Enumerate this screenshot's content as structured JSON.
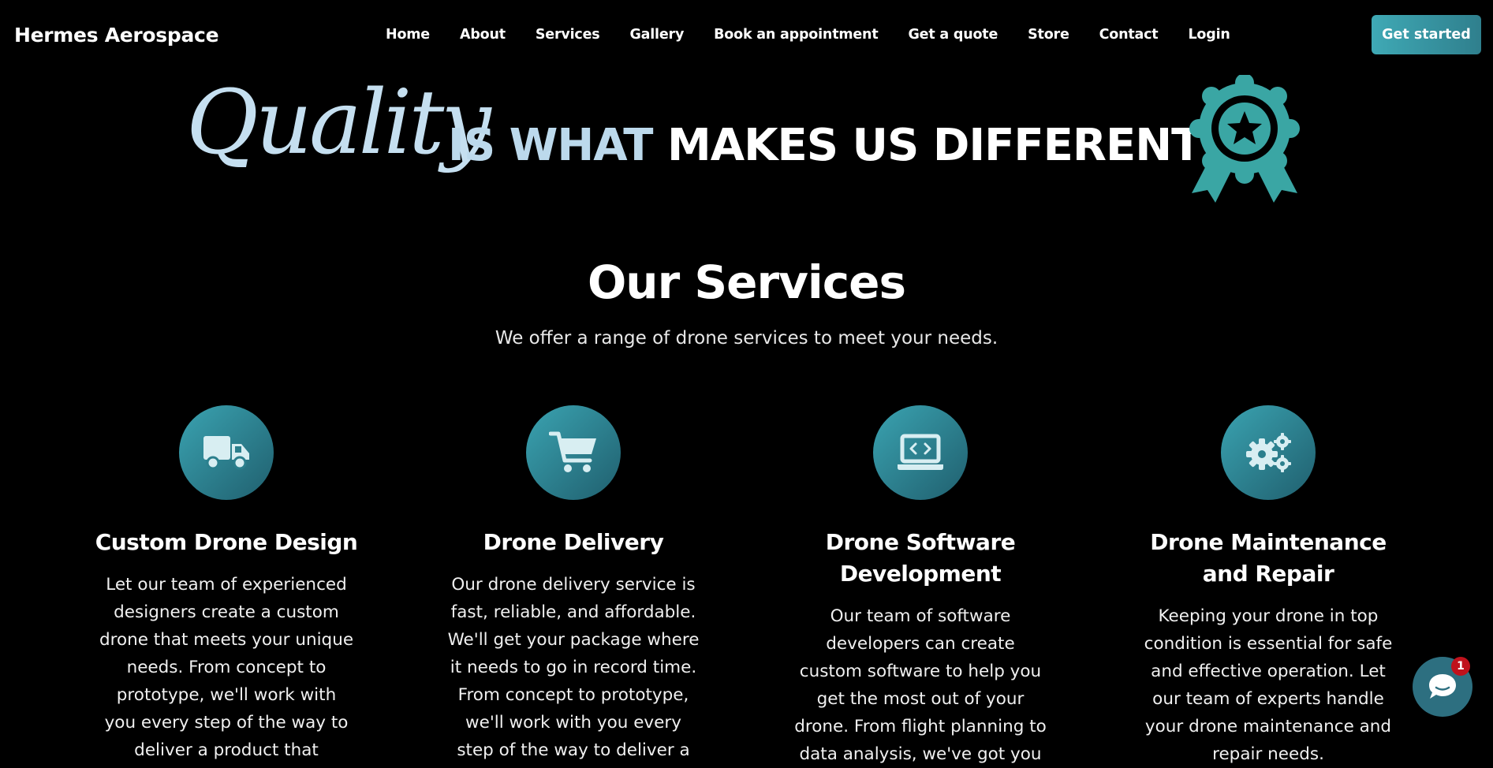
{
  "nav": {
    "brand": "Hermes Aerospace",
    "items": [
      "Home",
      "About",
      "Services",
      "Gallery",
      "Book an appointment",
      "Get a quote",
      "Store",
      "Contact",
      "Login"
    ],
    "cta_label": "Get started"
  },
  "hero": {
    "script_word": "Quality",
    "line_part1": "IS WHAT",
    "line_part2": "MAKES US DIFFERENT",
    "badge_icon": "award-ribbon-star-icon"
  },
  "services": {
    "title": "Our Services",
    "subtitle": "We offer a range of drone services to meet your needs.",
    "cards": [
      {
        "icon": "truck-icon",
        "title": "Custom Drone Design",
        "description": "Let our team of experienced designers create a custom drone that meets your unique needs. From concept to prototype, we'll work with you every step of the way to deliver a product that"
      },
      {
        "icon": "cart-icon",
        "title": "Drone Delivery",
        "description": "Our drone delivery service is fast, reliable, and affordable. We'll get your package where it needs to go in record time. From concept to prototype, we'll work with you every step of the way to deliver a"
      },
      {
        "icon": "laptop-code-icon",
        "title": "Drone Software Development",
        "description": "Our team of software developers can create custom software to help you get the most out of your drone. From flight planning to data analysis, we've got you"
      },
      {
        "icon": "gears-icon",
        "title": "Drone Maintenance and Repair",
        "description": "Keeping your drone in top condition is essential for safe and effective operation. Let our team of experts handle your drone maintenance and repair needs."
      }
    ]
  },
  "chat": {
    "icon": "chat-bubble-icon",
    "unread_count": "1"
  },
  "colors": {
    "accent": "#3fa9b5",
    "accent_dark": "#205f6e",
    "hero_light_blue": "#bcd9ec",
    "badge_teal": "#3aa6a4",
    "notification_red": "#c0121c"
  }
}
